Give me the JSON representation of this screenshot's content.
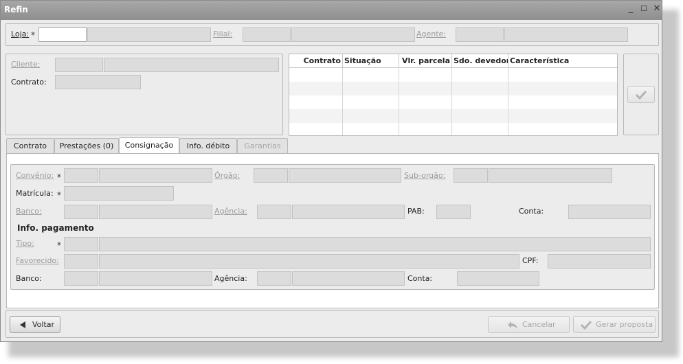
{
  "window": {
    "title": "Refin",
    "minimize": "_",
    "maximize": "☐",
    "close": "✕"
  },
  "header": {
    "loja_label": "Loja:",
    "required_mark": "*",
    "filial_label": "Filial:",
    "agente_label": "Agente:"
  },
  "cliente_panel": {
    "cliente_label": "Cliente:",
    "contrato_label": "Contrato:"
  },
  "contracts_table": {
    "columns": [
      "Contrato",
      "Situação",
      "Vlr. parcela",
      "Sdo. devedor",
      "Característica"
    ],
    "rows": []
  },
  "tabs": [
    {
      "label": "Contrato",
      "active": false,
      "enabled": true
    },
    {
      "label": "Prestações (0)",
      "active": false,
      "enabled": true
    },
    {
      "label": "Consignação",
      "active": true,
      "enabled": true
    },
    {
      "label": "Info. débito",
      "active": false,
      "enabled": true
    },
    {
      "label": "Garantias",
      "active": false,
      "enabled": false
    }
  ],
  "consignacao": {
    "convenio_label": "Convênio:",
    "orgao_label": "Órgão:",
    "suborgao_label": "Sub-orgão:",
    "matricula_label": "Matrícula:",
    "banco_label": "Banco:",
    "agencia_label": "Agência:",
    "pab_label": "PAB:",
    "conta_label": "Conta:",
    "info_pagamento_title": "Info. pagamento",
    "tipo_label": "Tipo:",
    "favorecido_label": "Favorecido:",
    "cpf_label": "CPF:",
    "pag_banco_label": "Banco:",
    "pag_agencia_label": "Agência:",
    "pag_conta_label": "Conta:"
  },
  "footer": {
    "voltar": "Voltar",
    "cancelar": "Cancelar",
    "gerar_proposta": "Gerar proposta"
  },
  "colors": {
    "titlebar": "#9a9a9a",
    "panel_bg": "#ececec",
    "field_disabled": "#dcdcdc",
    "link_disabled": "#9a9a9a"
  }
}
